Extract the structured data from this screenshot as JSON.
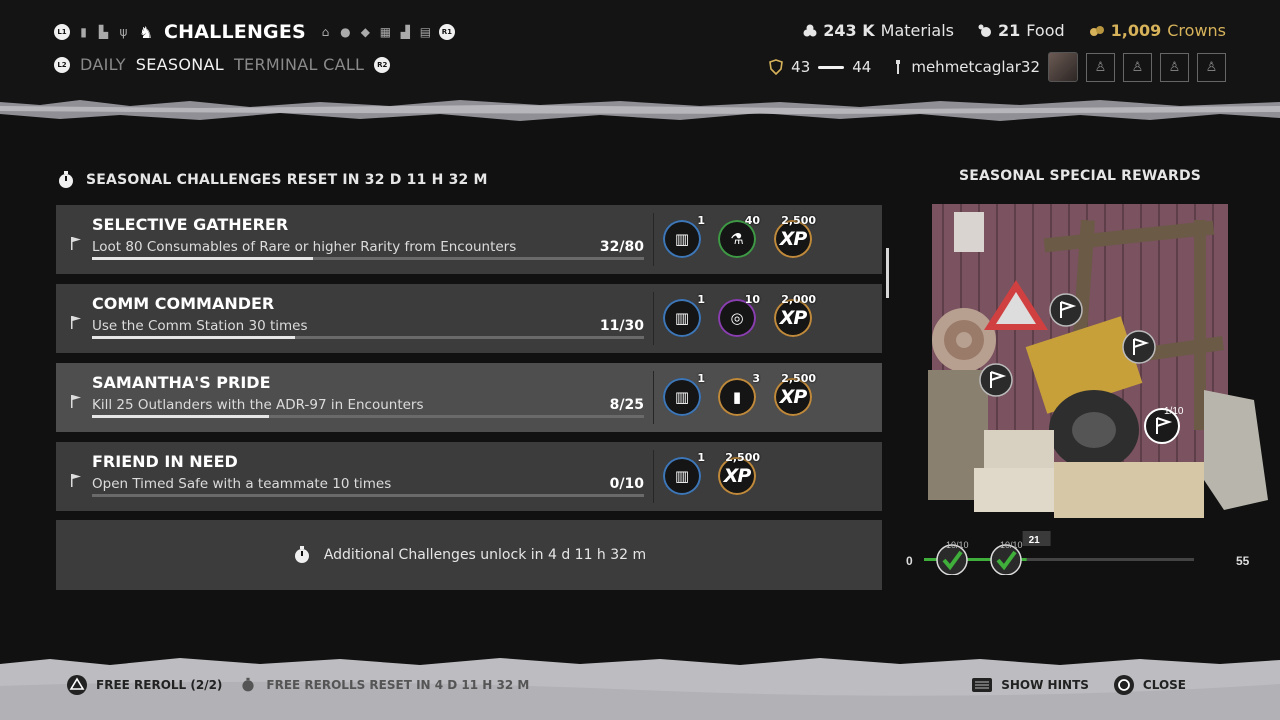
{
  "header": {
    "title": "CHALLENGES",
    "left_bumper": "L1",
    "right_bumper": "R1",
    "tab_left_btn": "L2",
    "tab_right_btn": "R2",
    "tabs": [
      {
        "label": "DAILY",
        "active": false
      },
      {
        "label": "SEASONAL",
        "active": true
      },
      {
        "label": "TERMINAL CALL",
        "active": false
      }
    ]
  },
  "resources": {
    "materials": {
      "value": "243 K",
      "label": "Materials"
    },
    "food": {
      "value": "21",
      "label": "Food"
    },
    "crowns": {
      "value": "1,009",
      "label": "Crowns"
    }
  },
  "player": {
    "level_current": "43",
    "level_next": "44",
    "level_progress": 0.85,
    "username": "mehmetcaglar32"
  },
  "seasonal": {
    "reset_text": "SEASONAL CHALLENGES RESET IN 32 D 11 H 32 M"
  },
  "challenges": [
    {
      "title": "SELECTIVE GATHERER",
      "description": "Loot 80 Consumables of Rare or higher Rarity from Encounters",
      "progress_text": "32/80",
      "progress": 0.4,
      "highlighted": false,
      "rewards": [
        {
          "icon": "armor-crate-icon",
          "qty": "1"
        },
        {
          "icon": "flask-icon",
          "qty": "40"
        },
        {
          "icon": "xp-icon",
          "label": "XP",
          "qty": "2,500"
        }
      ]
    },
    {
      "title": "COMM COMMANDER",
      "description": "Use the Comm Station 30 times",
      "progress_text": "11/30",
      "progress": 0.367,
      "highlighted": false,
      "rewards": [
        {
          "icon": "materials-crate-icon",
          "qty": "1"
        },
        {
          "icon": "coil-icon",
          "qty": "10"
        },
        {
          "icon": "xp-icon",
          "label": "XP",
          "qty": "2,000"
        }
      ]
    },
    {
      "title": "SAMANTHA'S PRIDE",
      "description": "Kill 25 Outlanders with the ADR-97 in Encounters",
      "progress_text": "8/25",
      "progress": 0.32,
      "highlighted": true,
      "rewards": [
        {
          "icon": "armor-crate-icon",
          "qty": "1"
        },
        {
          "icon": "canister-icon",
          "qty": "3"
        },
        {
          "icon": "xp-icon",
          "label": "XP",
          "qty": "2,500"
        }
      ]
    },
    {
      "title": "FRIEND IN NEED",
      "description": "Open Timed Safe with a teammate 10 times",
      "progress_text": "0/10",
      "progress": 0.0,
      "highlighted": false,
      "rewards": [
        {
          "icon": "armor-crate-icon",
          "qty": "1"
        },
        {
          "icon": "xp-icon",
          "label": "XP",
          "qty": "2,500"
        }
      ]
    }
  ],
  "unlock": {
    "text": "Additional Challenges unlock in 4 d 11 h 32 m"
  },
  "special_rewards": {
    "title": "SEASONAL SPECIAL REWARDS",
    "track_start": "0",
    "track_end": "55",
    "current_marker": "21",
    "milestone_1": "10/10",
    "milestone_2": "10/10",
    "image_milestone": "1/10",
    "progress": 0.38
  },
  "footer": {
    "reroll": "FREE REROLL (2/2)",
    "reroll_reset": "FREE REROLLS RESET IN 4 D 11 H 32 M",
    "show_hints": "SHOW HINTS",
    "close": "CLOSE"
  },
  "colors": {
    "background": "#111111",
    "card": "#3c3c3c",
    "card_highlight": "#4e4e4e",
    "crowns": "#d6b25a",
    "rare_ring": "#3e77b8",
    "uncommon_ring": "#3f9a46",
    "epic_ring": "#8a3fb0",
    "legendary_ring": "#c08a3c",
    "milestone_green": "#3fae3a"
  }
}
